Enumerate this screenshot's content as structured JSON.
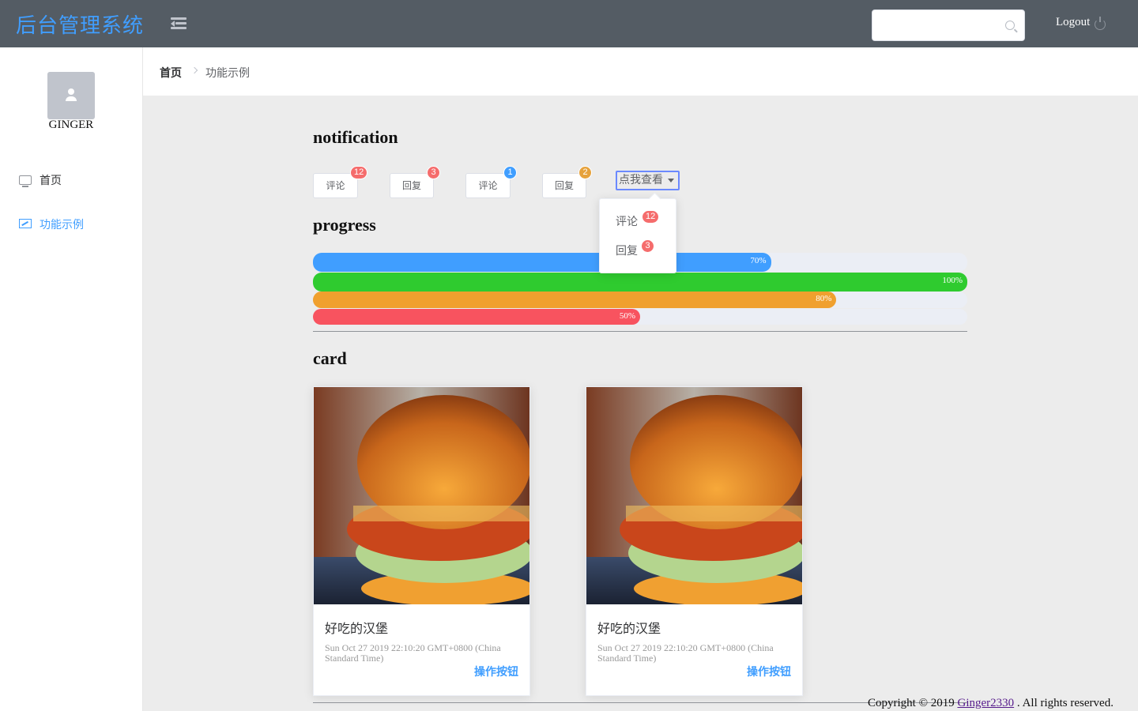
{
  "header": {
    "app_title": "后台管理系统",
    "search": {
      "placeholder": "",
      "value": ""
    },
    "logout_label": "Logout"
  },
  "sidebar": {
    "username": "GINGER",
    "items": [
      {
        "label": "首页",
        "icon": "monitor-icon",
        "active": false
      },
      {
        "label": "功能示例",
        "icon": "presentation-icon",
        "active": true
      }
    ]
  },
  "breadcrumb": {
    "home": "首页",
    "current": "功能示例"
  },
  "sections": {
    "notification": "notification",
    "progress": "progress",
    "card": "card"
  },
  "notification": {
    "buttons": [
      {
        "label": "评论",
        "badge": "12",
        "badge_color": "#f56c6c"
      },
      {
        "label": "回复",
        "badge": "3",
        "badge_color": "#f56c6c"
      },
      {
        "label": "评论",
        "badge": "1",
        "badge_color": "#409eff"
      },
      {
        "label": "回复",
        "badge": "2",
        "badge_color": "#e6a23c"
      }
    ],
    "dropdown": {
      "label": "点我查看",
      "items": [
        {
          "label": "评论",
          "badge": "12"
        },
        {
          "label": "回复",
          "badge": "3"
        }
      ]
    }
  },
  "progress": [
    {
      "percent": 70,
      "text": "70%",
      "color": "#409eff"
    },
    {
      "percent": 100,
      "text": "100%",
      "color": "#2fcb2f"
    },
    {
      "percent": 80,
      "text": "80%",
      "color": "#f0a02e"
    },
    {
      "percent": 50,
      "text": "50%",
      "color": "#f8535f"
    }
  ],
  "cards": [
    {
      "title": "好吃的汉堡",
      "time": "Sun Oct 27 2019 22:10:20 GMT+0800 (China Standard Time)",
      "button": "操作按钮",
      "image": "hamburger-photo"
    },
    {
      "title": "好吃的汉堡",
      "time": "Sun Oct 27 2019 22:10:20 GMT+0800 (China Standard Time)",
      "button": "操作按钮",
      "image": "hamburger-photo"
    }
  ],
  "footer": {
    "prefix": "Copyright © 2019 ",
    "link": "Ginger2330",
    "suffix": " . All rights reserved."
  }
}
